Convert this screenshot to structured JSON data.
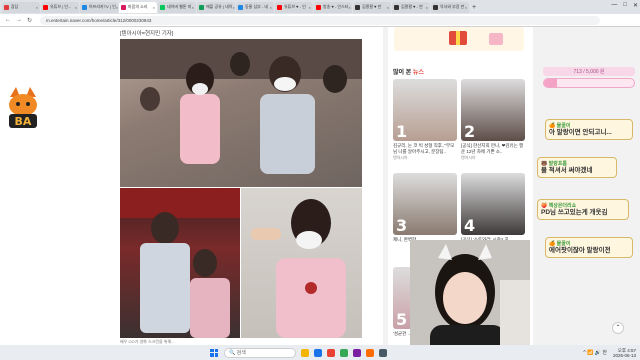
{
  "browser": {
    "tabs": [
      {
        "label": "잡담",
        "color": "#e23b3b",
        "active": false
      },
      {
        "label": "유튜브 | 인...",
        "color": "#ff0000",
        "active": false
      },
      {
        "label": "아프리카TV | 인",
        "color": "#1e88e5",
        "active": false
      },
      {
        "label": "마음의 소리",
        "color": "#d81b60",
        "active": true
      },
      {
        "label": "네이버 웹툰 미",
        "color": "#03c75a",
        "active": false
      },
      {
        "label": "애플 공유 | 네이",
        "color": "#0f9d58",
        "active": false
      },
      {
        "label": "동물 심부 - 네",
        "color": "#1e88e5",
        "active": false
      },
      {
        "label": "유튜브 ♥ - 인",
        "color": "#ff0000",
        "active": false
      },
      {
        "label": "방송 ♥ - 인스타",
        "color": "#ff0000",
        "active": false
      },
      {
        "label": "김팔팔 ♥ 만",
        "color": "#333333",
        "active": false
      },
      {
        "label": "김팔팔 ♥ - 만",
        "color": "#333333",
        "active": false
      },
      {
        "label": "악사와 부장 만",
        "color": "#333333",
        "active": false
      }
    ],
    "new_tab": "+",
    "controls": [
      "—",
      "□",
      "✕"
    ],
    "url": "m.entertain.naver.com/home/article/312/0000230843"
  },
  "article": {
    "caption": "[텐아시아=현지민 기자]",
    "footer": "배우 OO가 영화 스크린을 위해...",
    "photo_colors": {
      "photo1": "#8c7b72",
      "photo2": "#7a2a2a",
      "photo3": "#c6c0ba"
    }
  },
  "news": {
    "heading_prefix": "많이 본",
    "heading_highlight": "뉴스",
    "cards": [
      {
        "num": "1",
        "title": "김규리, 눈 코 빅 성형 직후..\"부모님 나를 알아주시고, 분장팀..",
        "src": "텐아시아",
        "color": "#b79e92"
      },
      {
        "num": "2",
        "title": "[공식] 한선지희 만나, ❤김유는 행운 12년 차에 기쁜 소..",
        "src": "텐아시아",
        "color": "#5e4d48"
      },
      {
        "num": "3",
        "title": "제니, 완벽한 ..",
        "src": "",
        "color": "#8a7a70"
      },
      {
        "num": "4",
        "title": "[공식] '소토와리' 시즌2 포..",
        "src": "",
        "color": "#3f3a3a"
      },
      {
        "num": "5",
        "title": "'성균관 ..",
        "src": "",
        "color": "#caa0a8"
      }
    ]
  },
  "panel": {
    "progress_text": "713 / 5,000 원",
    "progress_fraction": 0.143,
    "bubbles": [
      {
        "name": "🍊 물꿀이",
        "msg": "아 말랑이면 안되고니..."
      },
      {
        "name": "🐻 말랑프롬",
        "msg": "물 적셔서 써야겠네"
      },
      {
        "name": "🍑 책상은더리쇼",
        "msg": "PD님 쓰고있는게 개웃김"
      },
      {
        "name": "🍊 물꿀이",
        "msg": "에어팟이잖아 말랑이전"
      }
    ]
  },
  "taskbar": {
    "search_placeholder": "검색",
    "time": "오후 4:57",
    "date": "2025-06-13",
    "tray": "^ 📶 🔊 한"
  },
  "logo_text": "BA"
}
